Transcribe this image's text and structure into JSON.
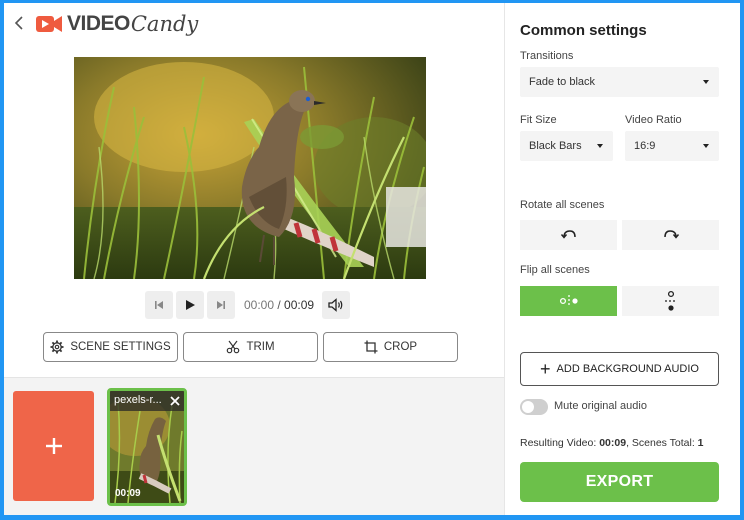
{
  "app": {
    "logo_word1": "VIDEO",
    "logo_word2": "Candy",
    "brand_color": "#ef5b3f",
    "accent_green": "#6cc04a",
    "frame_color": "#2196f3"
  },
  "player": {
    "current_time": "00:00",
    "separator": " / ",
    "total_time": "00:09"
  },
  "actions": {
    "scene_settings": "SCENE SETTINGS",
    "trim": "TRIM",
    "crop": "CROP"
  },
  "scenes": {
    "add_icon": "plus-icon",
    "items": [
      {
        "name": "pexels-r...",
        "duration": "00:09"
      }
    ]
  },
  "settings": {
    "title": "Common settings",
    "transitions_label": "Transitions",
    "transitions_value": "Fade to black",
    "fit_size_label": "Fit Size",
    "fit_size_value": "Black Bars",
    "video_ratio_label": "Video Ratio",
    "video_ratio_value": "16:9",
    "rotate_label": "Rotate all scenes",
    "flip_label": "Flip all scenes",
    "add_audio": "ADD BACKGROUND AUDIO",
    "mute_label": "Mute original audio",
    "mute_on": false,
    "result_prefix": "Resulting Video: ",
    "result_duration": "00:09",
    "result_mid": ", Scenes Total: ",
    "result_scenes": "1",
    "export": "EXPORT"
  }
}
